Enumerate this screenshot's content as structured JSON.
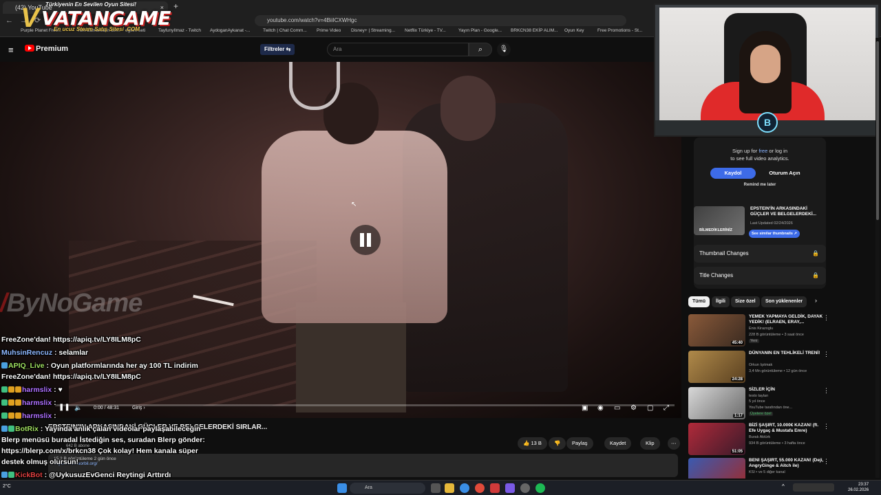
{
  "browser": {
    "tab_title": "(42) YouTube",
    "tab_close": "×",
    "new_tab": "+",
    "url": "youtube.com/watch?v=4BiiICXWHgc",
    "nav_buttons": "←→⟳",
    "bookmarks": [
      "Purple Planet Free...",
      "Tüm Zamanların En...",
      "eğitim seti",
      "TayfunyIlmaz - Twitch",
      "AydoganAykanat -...",
      "Twitch | Chat Comm...",
      "Prime Video",
      "Disney+ | Streaming...",
      "Netflix Türkiye - TV...",
      "Yayın Plan - Google...",
      "BRKCN38 EKİP ALIM...",
      "Oyun Key",
      "Free Promotions - St..."
    ]
  },
  "overlay_logo": {
    "tagline": "Türkiyenin En Sevilen Oyun Sitesi!",
    "brand": "VATANGAME",
    "sub": "En ucuz Steam Satış Sitesi .COM",
    "v_mark": "V"
  },
  "youtube": {
    "brand": "Premium",
    "menu_icon": "≡",
    "filters_label": "Filtreler ⇆",
    "search_placeholder": "Ara",
    "search_icon": "⌕",
    "mic_icon": "🎙"
  },
  "player": {
    "watermark": "ByNoGame",
    "watermark_mark": "/",
    "time": "0:00 / 48:31",
    "chapter": "Giriş ›",
    "progress": 0.0,
    "cursor": "↖"
  },
  "video": {
    "title": "EPSTEIN'IN ARKASINDAKİ GÜÇLER VE BELGELERDEKİ SIRLAR...",
    "channel_subs": "642 B abone",
    "likes": "13 B",
    "actions": {
      "like_icon": "👍",
      "dislike_icon": "👎",
      "share": "Paylaş",
      "save": "Kaydet",
      "clip": "Klip",
      "more": "⋯"
    },
    "desc_views": "15,2 B görüntüleme  2 gün önce",
    "desc_link": "https://www.sorbil.org/"
  },
  "chat": [
    {
      "nick": "",
      "text": "FreeZone'dan! https://apiq.tv/LY8ILM8pC"
    },
    {
      "nick": "MuhsinRencuz",
      "text": " : selamlar"
    },
    {
      "nick": "APIQ_Live",
      "text": " : Oyun platformlarında her ay 100 TL indirim"
    },
    {
      "nick": "",
      "text": "FreeZone'dan! https://apiq.tv/LY8ILM8pC"
    },
    {
      "nick": "harmslix",
      "text": " : ♥"
    },
    {
      "nick": "harmslix",
      "text": " : "
    },
    {
      "nick": "harmslix",
      "text": " : "
    },
    {
      "nick": "BotRix",
      "text": " : Yayında anlık çalan videolar paylaşabileceğin"
    },
    {
      "nick": "",
      "text": "Blerp menüsü buradal İstediğin ses, suradan Blerp gönder:"
    },
    {
      "nick": "",
      "text": "https://blerp.com/x/brkcn38 Çok kolay! Hem kanala süper"
    },
    {
      "nick": "",
      "text": "destek olmuş olursun!"
    },
    {
      "nick": "KickBot",
      "text": " : @UykusuzEvGenci Reytingi Arttırdı"
    }
  ],
  "webcam": {
    "logo": "B"
  },
  "sidebar": {
    "signup_line1_pre": "Sign up for ",
    "signup_free": "free",
    "signup_line1_post": " or log in",
    "signup_line2": "to see full video analytics.",
    "btn_register": "Kaydol",
    "btn_login": "Oturum Açın",
    "remind": "Remind me later",
    "sim_thumb_label": "BİLMEDİKLERİNİZ",
    "sim_title": "EPSTEIN'İN ARKASINDAKİ GÜÇLER VE BELGELERDEKİ...",
    "sim_date": "Last Updated 02/24/2026",
    "sim_btn": "See similar thumbnails ↗",
    "row1": "Thumbnail Changes",
    "row2": "Title Changes",
    "lock_icon": "🔒"
  },
  "chips": [
    "Tümü",
    "İlgili",
    "Size özel",
    "Son yüklenenler"
  ],
  "chips_next": "›",
  "recommendations": [
    {
      "title": "YEMEK YAPMAYA GELDİK, DAYAK YEDİK! (ELRAEN, ERAY,...",
      "channel": "Enis Kirazoglu",
      "meta": "228 B görüntüleme • 3 saat önce",
      "extra": "Yeni",
      "duration": "45:40",
      "color": "#8a5a3a",
      "more": "⋮"
    },
    {
      "title": "DÜNYANIN EN TEHLİKELİ TRENİ!",
      "channel": "Orkun Işıtmak",
      "meta": "3,4 Mn görüntüleme • 12 gün önce",
      "extra": "",
      "duration": "24:28",
      "color": "#b08a4a",
      "more": "⋮"
    },
    {
      "title": "SİZLER İÇİN",
      "channel": "testo taylan",
      "meta": "5 yıl önce",
      "extra": "Üyelere özel",
      "meta2": "YouTube tarafından öne...",
      "duration": "1:17",
      "color": "#d8d8d8",
      "more": "⋮"
    },
    {
      "title": "BİZİ ŞAŞIRT, 10.000€ KAZAN! (ft. Efe Uygaç & Mustafa Emre)",
      "channel": "Burak Aktürk",
      "meta": "934 B görüntüleme • 3 hafta önce",
      "extra": "",
      "duration": "51:05",
      "color": "#b02a3a",
      "more": "⋮"
    },
    {
      "title": "BENİ ŞAŞIRT, 55.000 KAZAN! (Deji, AngryGinge & Aitch ile)",
      "channel": "KSI • ve 5 diğer kanal",
      "meta": "",
      "extra": "",
      "duration": "",
      "color": "#3a5ab0",
      "more": "⋮"
    }
  ],
  "taskbar": {
    "weather": "2°C",
    "search": "Ara",
    "time": "23:37",
    "date": "26.02.2026"
  }
}
